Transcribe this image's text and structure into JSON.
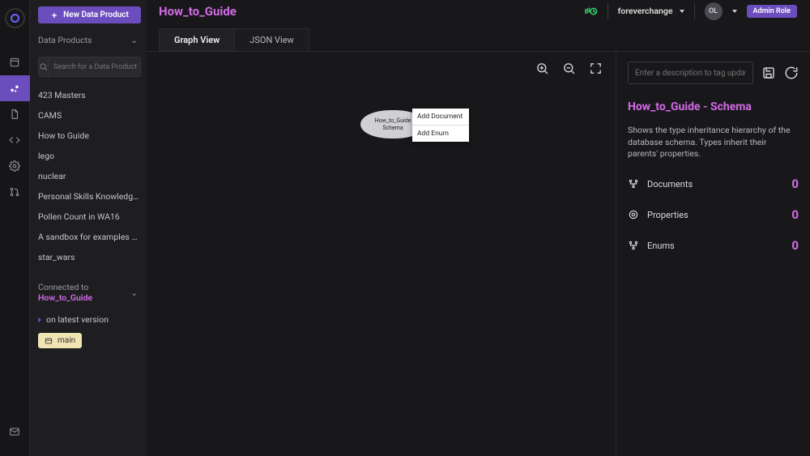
{
  "header": {
    "title": "How_to_Guide",
    "username": "foreverchange",
    "avatar_initials": "OL",
    "role_label": "Admin Role"
  },
  "sidebar": {
    "new_button": "New Data Product",
    "section_label": "Data Products",
    "search_placeholder": "Search for a Data Product",
    "items": [
      "423 Masters",
      "CAMS",
      "How to Guide",
      "lego",
      "nuclear",
      "Personal Skills Knowledge Gr…",
      "Pollen Count in WA16",
      "A sandbox for examples and r…",
      "star_wars"
    ],
    "connected_prefix": "Connected to ",
    "connected_product": "How_to_Guide",
    "latest_label": "on latest version",
    "branch_label": "main"
  },
  "tabs": {
    "graph": "Graph View",
    "json": "JSON View"
  },
  "node": {
    "label_line1": "How_to_Guide",
    "label_line2": "Schema",
    "close": "X"
  },
  "context_menu": {
    "add_document": "Add Document",
    "add_enum": "Add Enum"
  },
  "rpanel": {
    "tag_placeholder": "Enter a description to tag update",
    "title": "How_to_Guide - Schema",
    "description": "Shows the type inheritance hierarchy of the database schema. Types inherit their parents' properties.",
    "stats": {
      "documents_label": "Documents",
      "documents_count": "0",
      "properties_label": "Properties",
      "properties_count": "0",
      "enums_label": "Enums",
      "enums_count": "0"
    }
  }
}
